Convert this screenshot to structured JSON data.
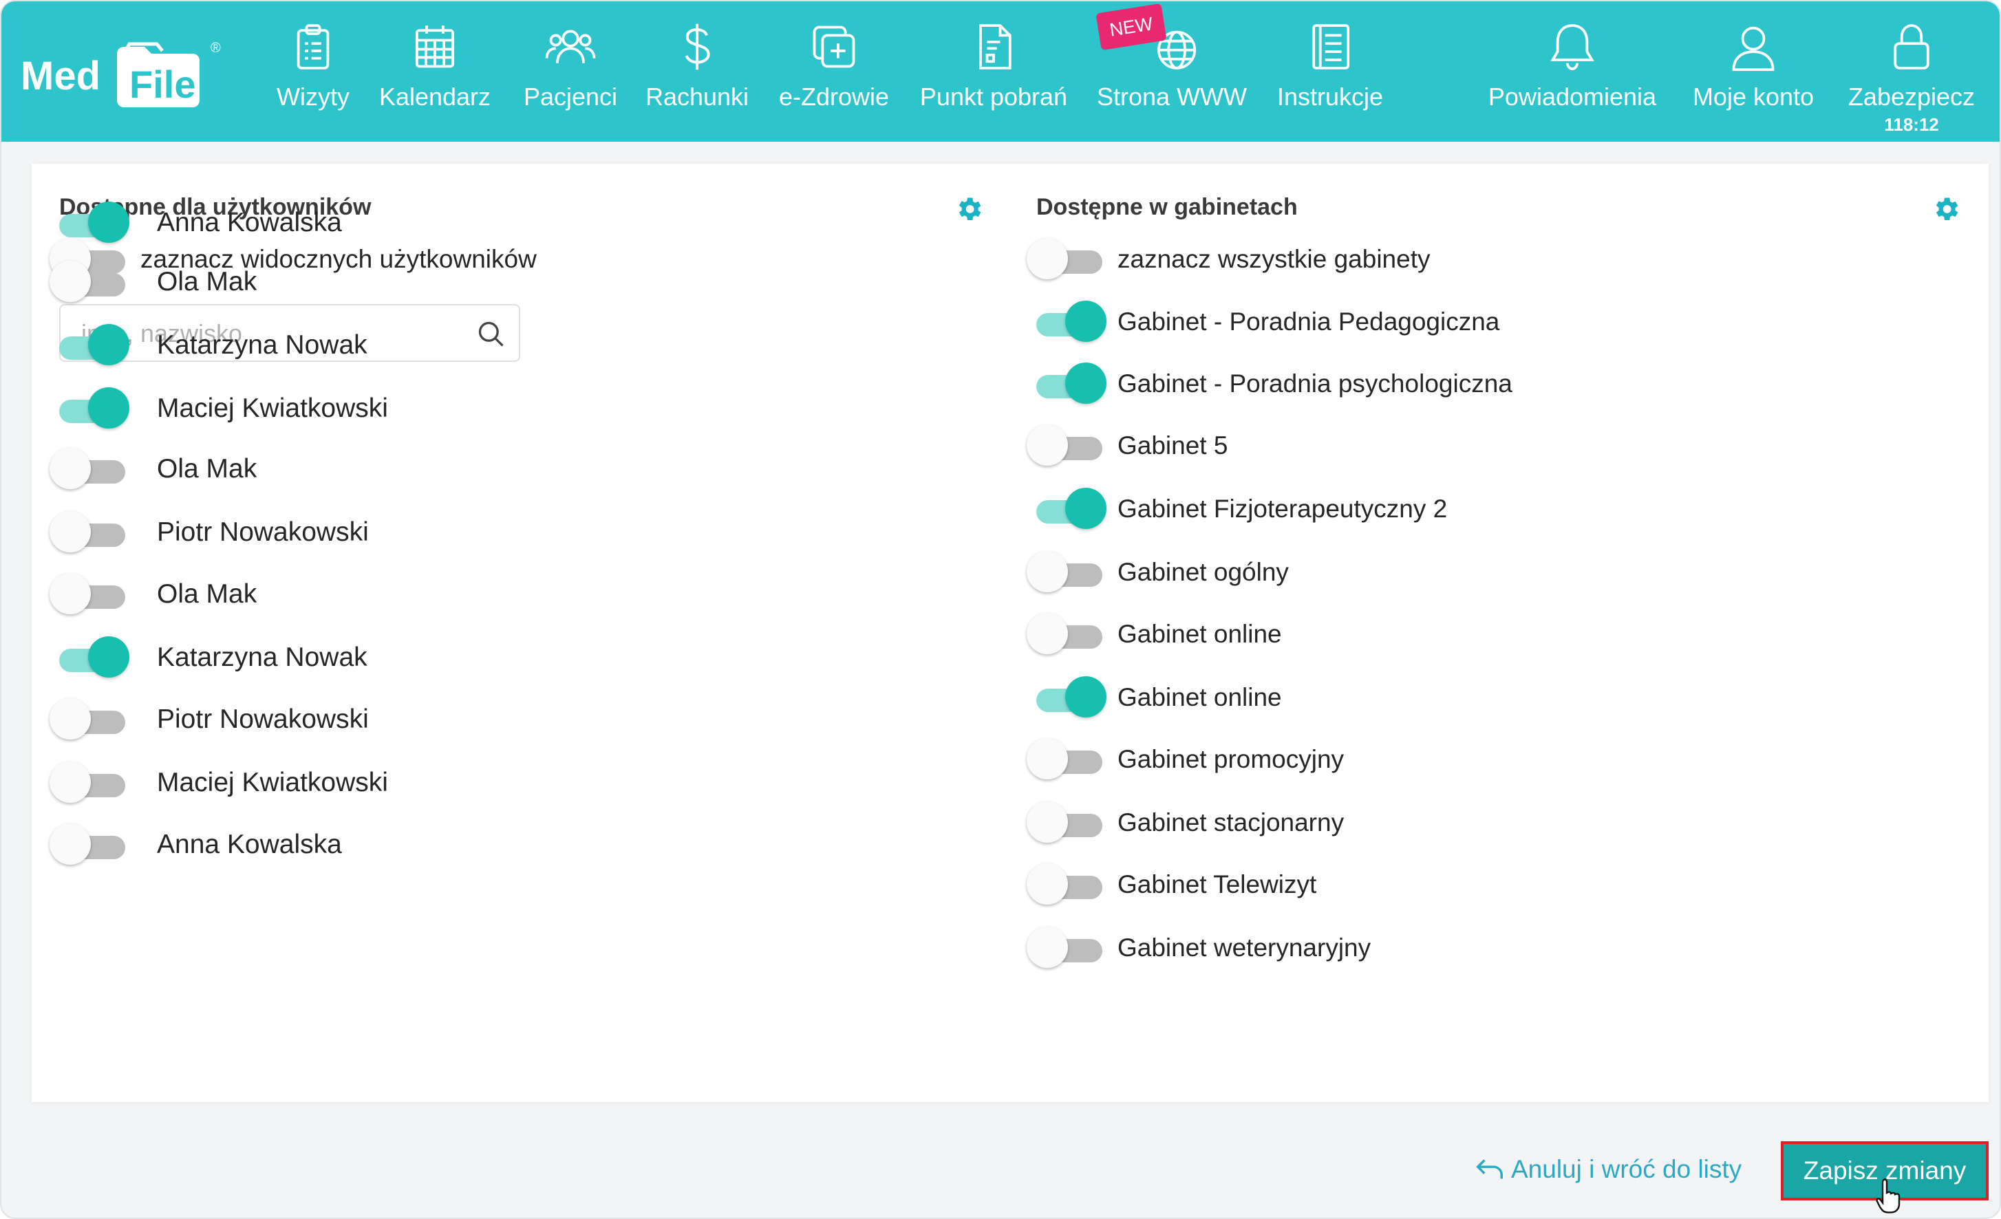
{
  "app": {
    "logo_med": "Med",
    "logo_file": "File",
    "logo_reg": "®"
  },
  "nav": {
    "items": [
      {
        "label": "Wizyty",
        "icon": "clipboard-icon"
      },
      {
        "label": "Kalendarz",
        "icon": "calendar-icon"
      },
      {
        "label": "Pacjenci",
        "icon": "users-icon"
      },
      {
        "label": "Rachunki",
        "icon": "dollar-icon"
      },
      {
        "label": "e-Zdrowie",
        "icon": "medical-plus-icon"
      },
      {
        "label": "Punkt pobrań",
        "icon": "document-icon"
      },
      {
        "label": "Strona WWW",
        "icon": "globe-icon"
      },
      {
        "label": "Instrukcje",
        "icon": "book-icon"
      },
      {
        "label": "Powiadomienia",
        "icon": "bell-icon"
      },
      {
        "label": "Moje konto",
        "icon": "user-icon"
      },
      {
        "label": "Zabezpiecz",
        "icon": "lock-icon"
      }
    ],
    "new_badge": "NEW",
    "session_timer": "118:12"
  },
  "left_panel": {
    "title": "Dostępne dla użytkowników",
    "select_visible": {
      "label": "zaznacz widocznych użytkowników",
      "checked": false
    },
    "search": {
      "placeholder": "imię, nazwisko",
      "value": ""
    },
    "users": [
      {
        "name": "Anna Kowalska",
        "enabled": true
      },
      {
        "name": "Ola Mak",
        "enabled": false
      },
      {
        "name": "Katarzyna Nowak",
        "enabled": true
      },
      {
        "name": "Maciej Kwiatkowski",
        "enabled": true
      },
      {
        "name": "Ola Mak",
        "enabled": false
      },
      {
        "name": "Piotr Nowakowski",
        "enabled": false
      },
      {
        "name": "Ola Mak",
        "enabled": false
      },
      {
        "name": "Katarzyna Nowak",
        "enabled": true
      },
      {
        "name": "Piotr Nowakowski",
        "enabled": false
      },
      {
        "name": "Maciej Kwiatkowski",
        "enabled": false
      },
      {
        "name": "Anna Kowalska",
        "enabled": false
      }
    ]
  },
  "right_panel": {
    "title": "Dostępne w gabinetach",
    "select_all": {
      "label": "zaznacz wszystkie gabinety",
      "checked": false
    },
    "rooms": [
      {
        "name": "Gabinet - Poradnia Pedagogiczna",
        "enabled": true
      },
      {
        "name": "Gabinet - Poradnia psychologiczna",
        "enabled": true
      },
      {
        "name": "Gabinet 5",
        "enabled": false
      },
      {
        "name": "Gabinet Fizjoterapeutyczny 2",
        "enabled": true
      },
      {
        "name": "Gabinet ogólny",
        "enabled": false
      },
      {
        "name": "Gabinet online",
        "enabled": false
      },
      {
        "name": "Gabinet online",
        "enabled": true
      },
      {
        "name": "Gabinet promocyjny",
        "enabled": false
      },
      {
        "name": "Gabinet stacjonarny",
        "enabled": false
      },
      {
        "name": "Gabinet Telewizyt",
        "enabled": false
      },
      {
        "name": "Gabinet weterynaryjny",
        "enabled": false
      }
    ]
  },
  "footer": {
    "cancel_label": "Anuluj i wróć do listy",
    "save_label": "Zapisz zmiany"
  },
  "colors": {
    "header": "#2ec4cc",
    "toggle_on": "#17c0ae",
    "link": "#2ba8c4",
    "save_button": "#1aa6a4",
    "highlight_border": "#e31e24",
    "gear": "#1bb3c4"
  }
}
